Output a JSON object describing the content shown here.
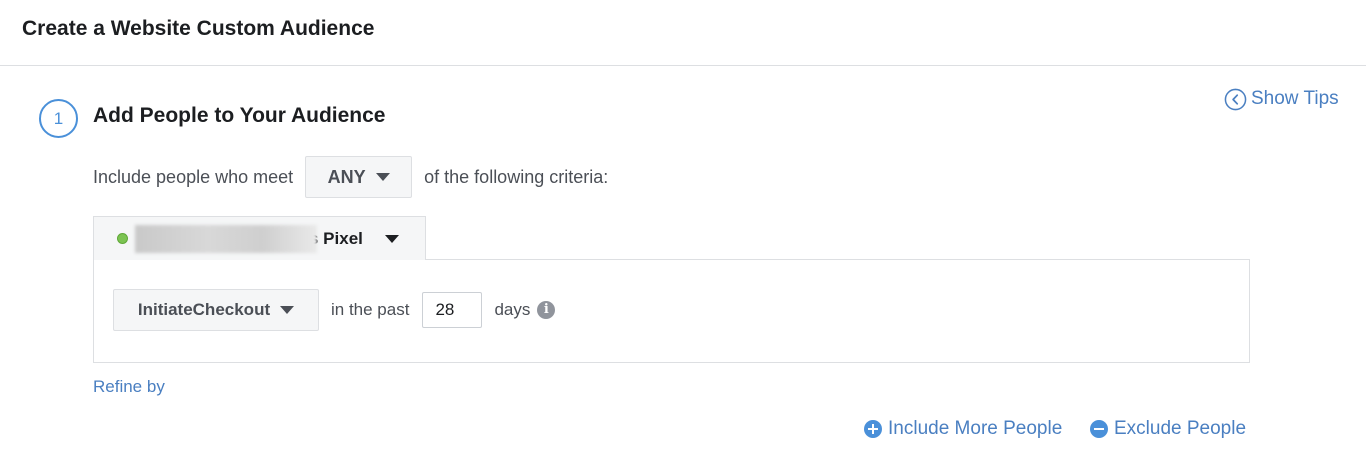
{
  "header": {
    "title": "Create a Website Custom Audience"
  },
  "step": {
    "number": "1",
    "title": "Add People to Your Audience"
  },
  "show_tips": {
    "label": "Show Tips",
    "icon": "chevron-left-circle-icon"
  },
  "criteria": {
    "prefix": "Include people who meet",
    "match_value": "ANY",
    "suffix": "of the following criteria:"
  },
  "pixel": {
    "name_visible": "s Pixel",
    "status_color": "#7cc352"
  },
  "rule": {
    "event": "InitiateCheckout",
    "in_the_past": "in the past",
    "days_value": "28",
    "days_label": "days",
    "info_icon": "i"
  },
  "refine_by": "Refine by",
  "actions": {
    "include_more": "Include More People",
    "exclude": "Exclude People"
  },
  "colors": {
    "accent": "#4a7fc1",
    "border": "#dddfe2",
    "button_bg": "#f5f6f7"
  }
}
